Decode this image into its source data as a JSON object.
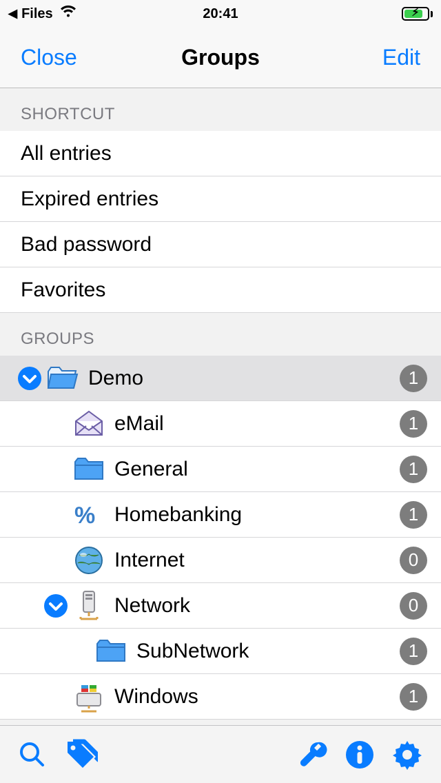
{
  "status": {
    "back_app": "Files",
    "time": "20:41"
  },
  "nav": {
    "close_label": "Close",
    "title": "Groups",
    "edit_label": "Edit"
  },
  "sections": {
    "shortcut_header": "SHORTCUT",
    "groups_header": "GROUPS"
  },
  "shortcuts": [
    {
      "label": "All entries"
    },
    {
      "label": "Expired entries"
    },
    {
      "label": "Bad password"
    },
    {
      "label": "Favorites"
    }
  ],
  "groups": [
    {
      "label": "Demo",
      "count": "1",
      "icon": "folder-open",
      "indent": 0,
      "expanded": true,
      "selected": true,
      "hasChildren": true
    },
    {
      "label": "eMail",
      "count": "1",
      "icon": "mail",
      "indent": 1,
      "hasChildren": false
    },
    {
      "label": "General",
      "count": "1",
      "icon": "folder",
      "indent": 1,
      "hasChildren": false
    },
    {
      "label": "Homebanking",
      "count": "1",
      "icon": "percent",
      "indent": 1,
      "hasChildren": false
    },
    {
      "label": "Internet",
      "count": "0",
      "icon": "globe",
      "indent": 1,
      "hasChildren": false
    },
    {
      "label": "Network",
      "count": "0",
      "icon": "server",
      "indent": 1,
      "expanded": true,
      "hasChildren": true
    },
    {
      "label": "SubNetwork",
      "count": "1",
      "icon": "folder",
      "indent": 2,
      "hasChildren": false
    },
    {
      "label": "Windows",
      "count": "1",
      "icon": "windows",
      "indent": 1,
      "hasChildren": false
    }
  ]
}
